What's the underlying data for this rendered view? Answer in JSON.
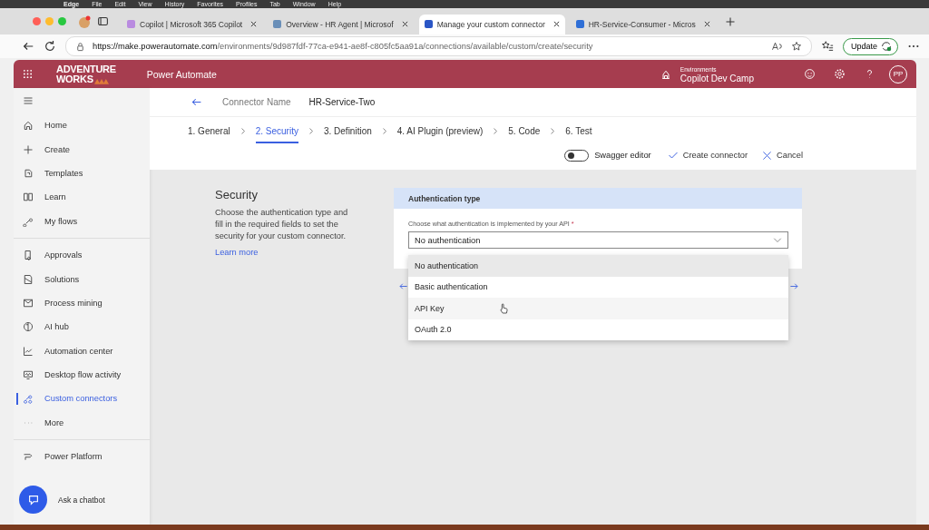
{
  "menu_bar": {
    "app": "Edge",
    "items": [
      "File",
      "Edit",
      "View",
      "History",
      "Favorites",
      "Profiles",
      "Tab",
      "Window",
      "Help"
    ]
  },
  "browser": {
    "tabs": [
      {
        "title": "Copilot | Microsoft 365 Copilot",
        "selected": false
      },
      {
        "title": "Overview - HR Agent | Microsof",
        "selected": false
      },
      {
        "title": "Manage your custom connector",
        "selected": true
      },
      {
        "title": "HR-Service-Consumer - Micros",
        "selected": false
      }
    ],
    "url_host": "https://make.powerautomate.com",
    "url_path": "/environments/9d987fdf-77ca-e941-ae8f-c805fc5aa91a/connections/available/custom/create/security",
    "update_button": "Update"
  },
  "app_header": {
    "logo_top": "ADVENTURE",
    "logo_bottom": "WORKS",
    "product": "Power Automate",
    "environment_label": "Environments",
    "environment": "Copilot Dev Camp",
    "avatar": "PP"
  },
  "sidebar": {
    "groups": [
      [
        {
          "label": "Home",
          "selected": false
        },
        {
          "label": "Create",
          "selected": false
        },
        {
          "label": "Templates",
          "selected": false
        },
        {
          "label": "Learn",
          "selected": false
        },
        {
          "label": "My flows",
          "selected": false
        }
      ],
      [
        {
          "label": "Approvals",
          "selected": false
        },
        {
          "label": "Solutions",
          "selected": false
        },
        {
          "label": "Process mining",
          "selected": false
        },
        {
          "label": "AI hub",
          "selected": false
        },
        {
          "label": "Automation center",
          "selected": false
        },
        {
          "label": "Desktop flow activity",
          "selected": false
        },
        {
          "label": "Custom connectors",
          "selected": true
        },
        {
          "label": "More",
          "selected": false
        }
      ],
      [
        {
          "label": "Power Platform",
          "selected": false
        }
      ]
    ],
    "chatbot": "Ask a chatbot"
  },
  "connector": {
    "label": "Connector Name",
    "value": "HR-Service-Two"
  },
  "steps": [
    {
      "label": "1. General",
      "selected": false
    },
    {
      "label": "2. Security",
      "selected": true
    },
    {
      "label": "3. Definition",
      "selected": false
    },
    {
      "label": "4. AI Plugin (preview)",
      "selected": false
    },
    {
      "label": "5. Code",
      "selected": false
    },
    {
      "label": "6. Test",
      "selected": false
    }
  ],
  "toolbar": {
    "swagger_editor": {
      "label": "Swagger editor",
      "on": false
    },
    "create": "Create connector",
    "cancel": "Cancel"
  },
  "section": {
    "title": "Security",
    "description": "Choose the authentication type and fill in the required fields to set the security for your custom connector.",
    "link": "Learn more"
  },
  "auth_card": {
    "header": "Authentication type",
    "field_label": "Choose what authentication is implemented by your API",
    "required_mark": "*",
    "value": "No authentication",
    "options": [
      {
        "label": "No authentication",
        "selected": true,
        "hovered": false
      },
      {
        "label": "Basic authentication",
        "selected": false,
        "hovered": false
      },
      {
        "label": "API Key",
        "selected": false,
        "hovered": true
      },
      {
        "label": "OAuth 2.0",
        "selected": false,
        "hovered": false
      }
    ]
  }
}
